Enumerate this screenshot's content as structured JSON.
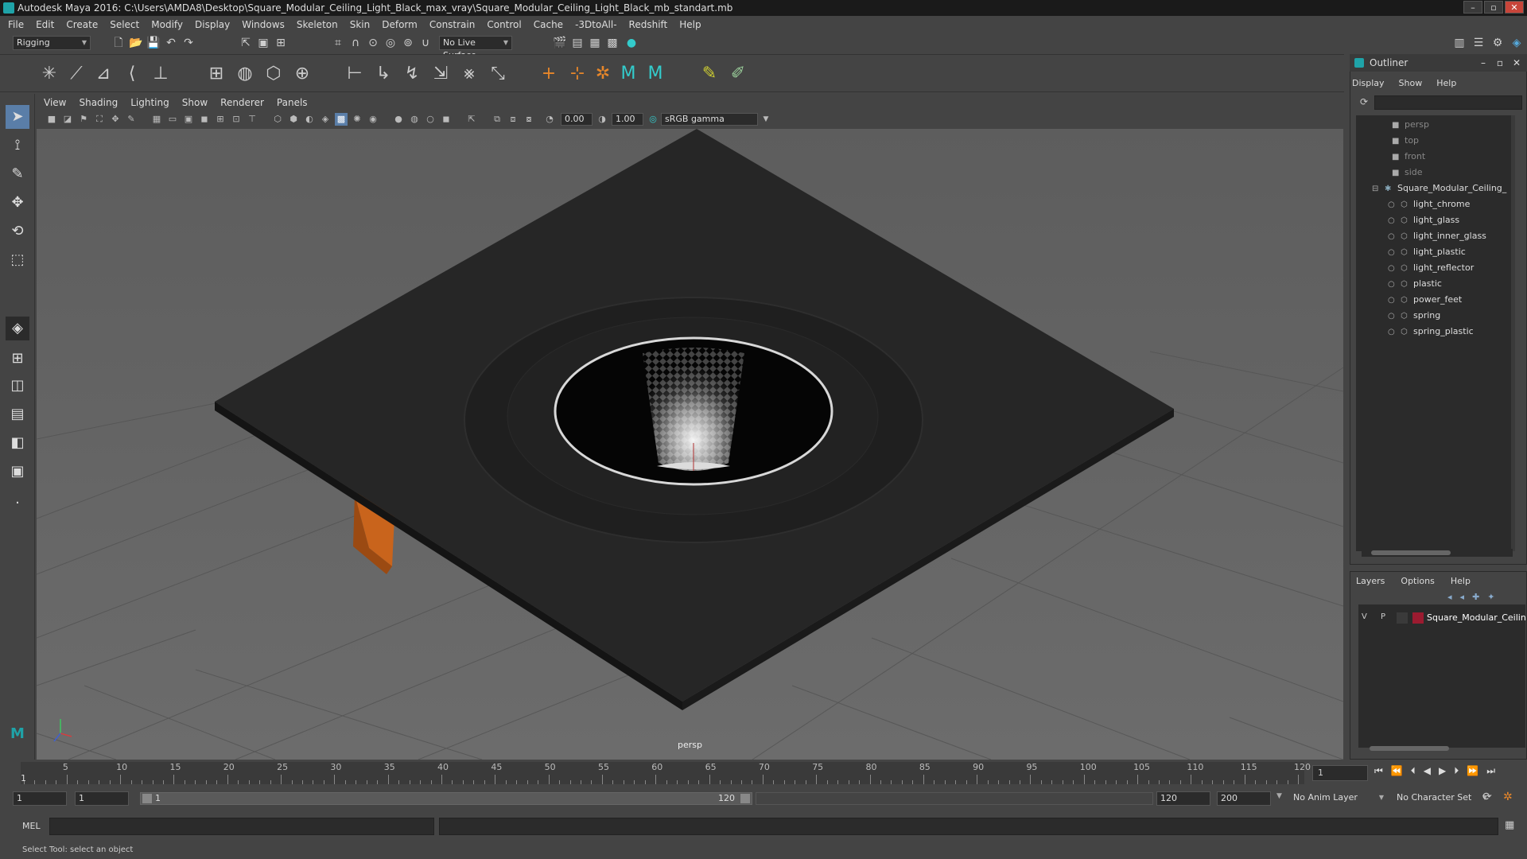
{
  "title_bar": {
    "text": "Autodesk Maya 2016: C:\\Users\\AMDA8\\Desktop\\Square_Modular_Ceiling_Light_Black_max_vray\\Square_Modular_Ceiling_Light_Black_mb_standart.mb"
  },
  "menu_bar": [
    "File",
    "Edit",
    "Create",
    "Select",
    "Modify",
    "Display",
    "Windows",
    "Skeleton",
    "Skin",
    "Deform",
    "Constrain",
    "Control",
    "Cache",
    "-3DtoAll-",
    "Redshift",
    "Help"
  ],
  "status_line": {
    "mode": "Rigging",
    "live_surface": "No Live Surface"
  },
  "viewport": {
    "menus": [
      "View",
      "Shading",
      "Lighting",
      "Show",
      "Renderer",
      "Panels"
    ],
    "field_a": "0.00",
    "field_b": "1.00",
    "color_space": "sRGB gamma",
    "camera_label": "persp"
  },
  "outliner": {
    "title": "Outliner",
    "menus": [
      "Display",
      "Show",
      "Help"
    ],
    "cameras": [
      "persp",
      "top",
      "front",
      "side"
    ],
    "group": "Square_Modular_Ceiling_",
    "children": [
      "light_chrome",
      "light_glass",
      "light_inner_glass",
      "light_plastic",
      "light_reflector",
      "plastic",
      "power_feet",
      "spring",
      "spring_plastic"
    ]
  },
  "layers": {
    "menus": [
      "Layers",
      "Options",
      "Help"
    ],
    "row": {
      "v": "V",
      "p": "P",
      "name": "Square_Modular_Ceilin",
      "color": "#9b1b30"
    }
  },
  "timeline": {
    "tick_labels": [
      "5",
      "10",
      "15",
      "20",
      "25",
      "30",
      "35",
      "40",
      "45",
      "50",
      "55",
      "60",
      "65",
      "70",
      "75",
      "80",
      "85",
      "90",
      "95",
      "100",
      "105",
      "110",
      "115",
      "120"
    ],
    "start_marker": "1",
    "current_frame": "1"
  },
  "range": {
    "start": "1",
    "start2": "1",
    "slider_start": "1",
    "slider_end": "120",
    "end": "120",
    "end2": "200",
    "anim_layer": "No Anim Layer",
    "character_set": "No Character Set"
  },
  "command_line": {
    "label": "MEL"
  },
  "help_line": {
    "text": "Select Tool: select an object"
  },
  "colors": {
    "accent": "#1fa3a8",
    "orange": "#c9641c"
  }
}
